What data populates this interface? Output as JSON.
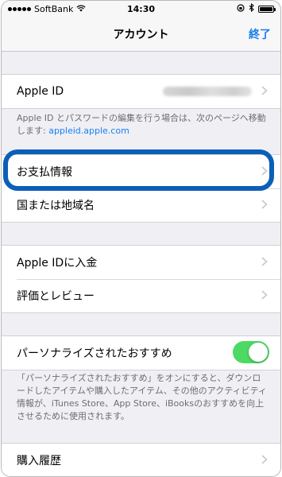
{
  "status_bar": {
    "carrier": "SoftBank",
    "time": "14:30",
    "battery_level": 1.0
  },
  "nav": {
    "title": "アカウント",
    "done": "終了"
  },
  "apple_id_section": {
    "label": "Apple ID",
    "footnote_text": "Apple ID とパスワードの編集を行う場合は、次のページへ移動します: ",
    "footnote_link": "appleid.apple.com"
  },
  "payment_section": {
    "payment_info": "お支払情報",
    "country_region": "国または地域名"
  },
  "store_section": {
    "add_funds": "Apple IDに入金",
    "ratings_reviews": "評価とレビュー"
  },
  "personalization": {
    "label": "パーソナライズされたおすすめ",
    "enabled": true,
    "footnote": "「パーソナライズされたおすすめ」をオンにすると、ダウンロードしたアイテムや購入したアイテム、その他のアクティビティ情報が、iTunes Store、App Store、iBooksのおすすめを向上させるために使用されます。"
  },
  "history_section": {
    "purchase_history": "購入履歴"
  },
  "colors": {
    "accent": "#1a7ef0",
    "highlight": "#0b5fb8",
    "toggle_on": "#4cd964"
  }
}
